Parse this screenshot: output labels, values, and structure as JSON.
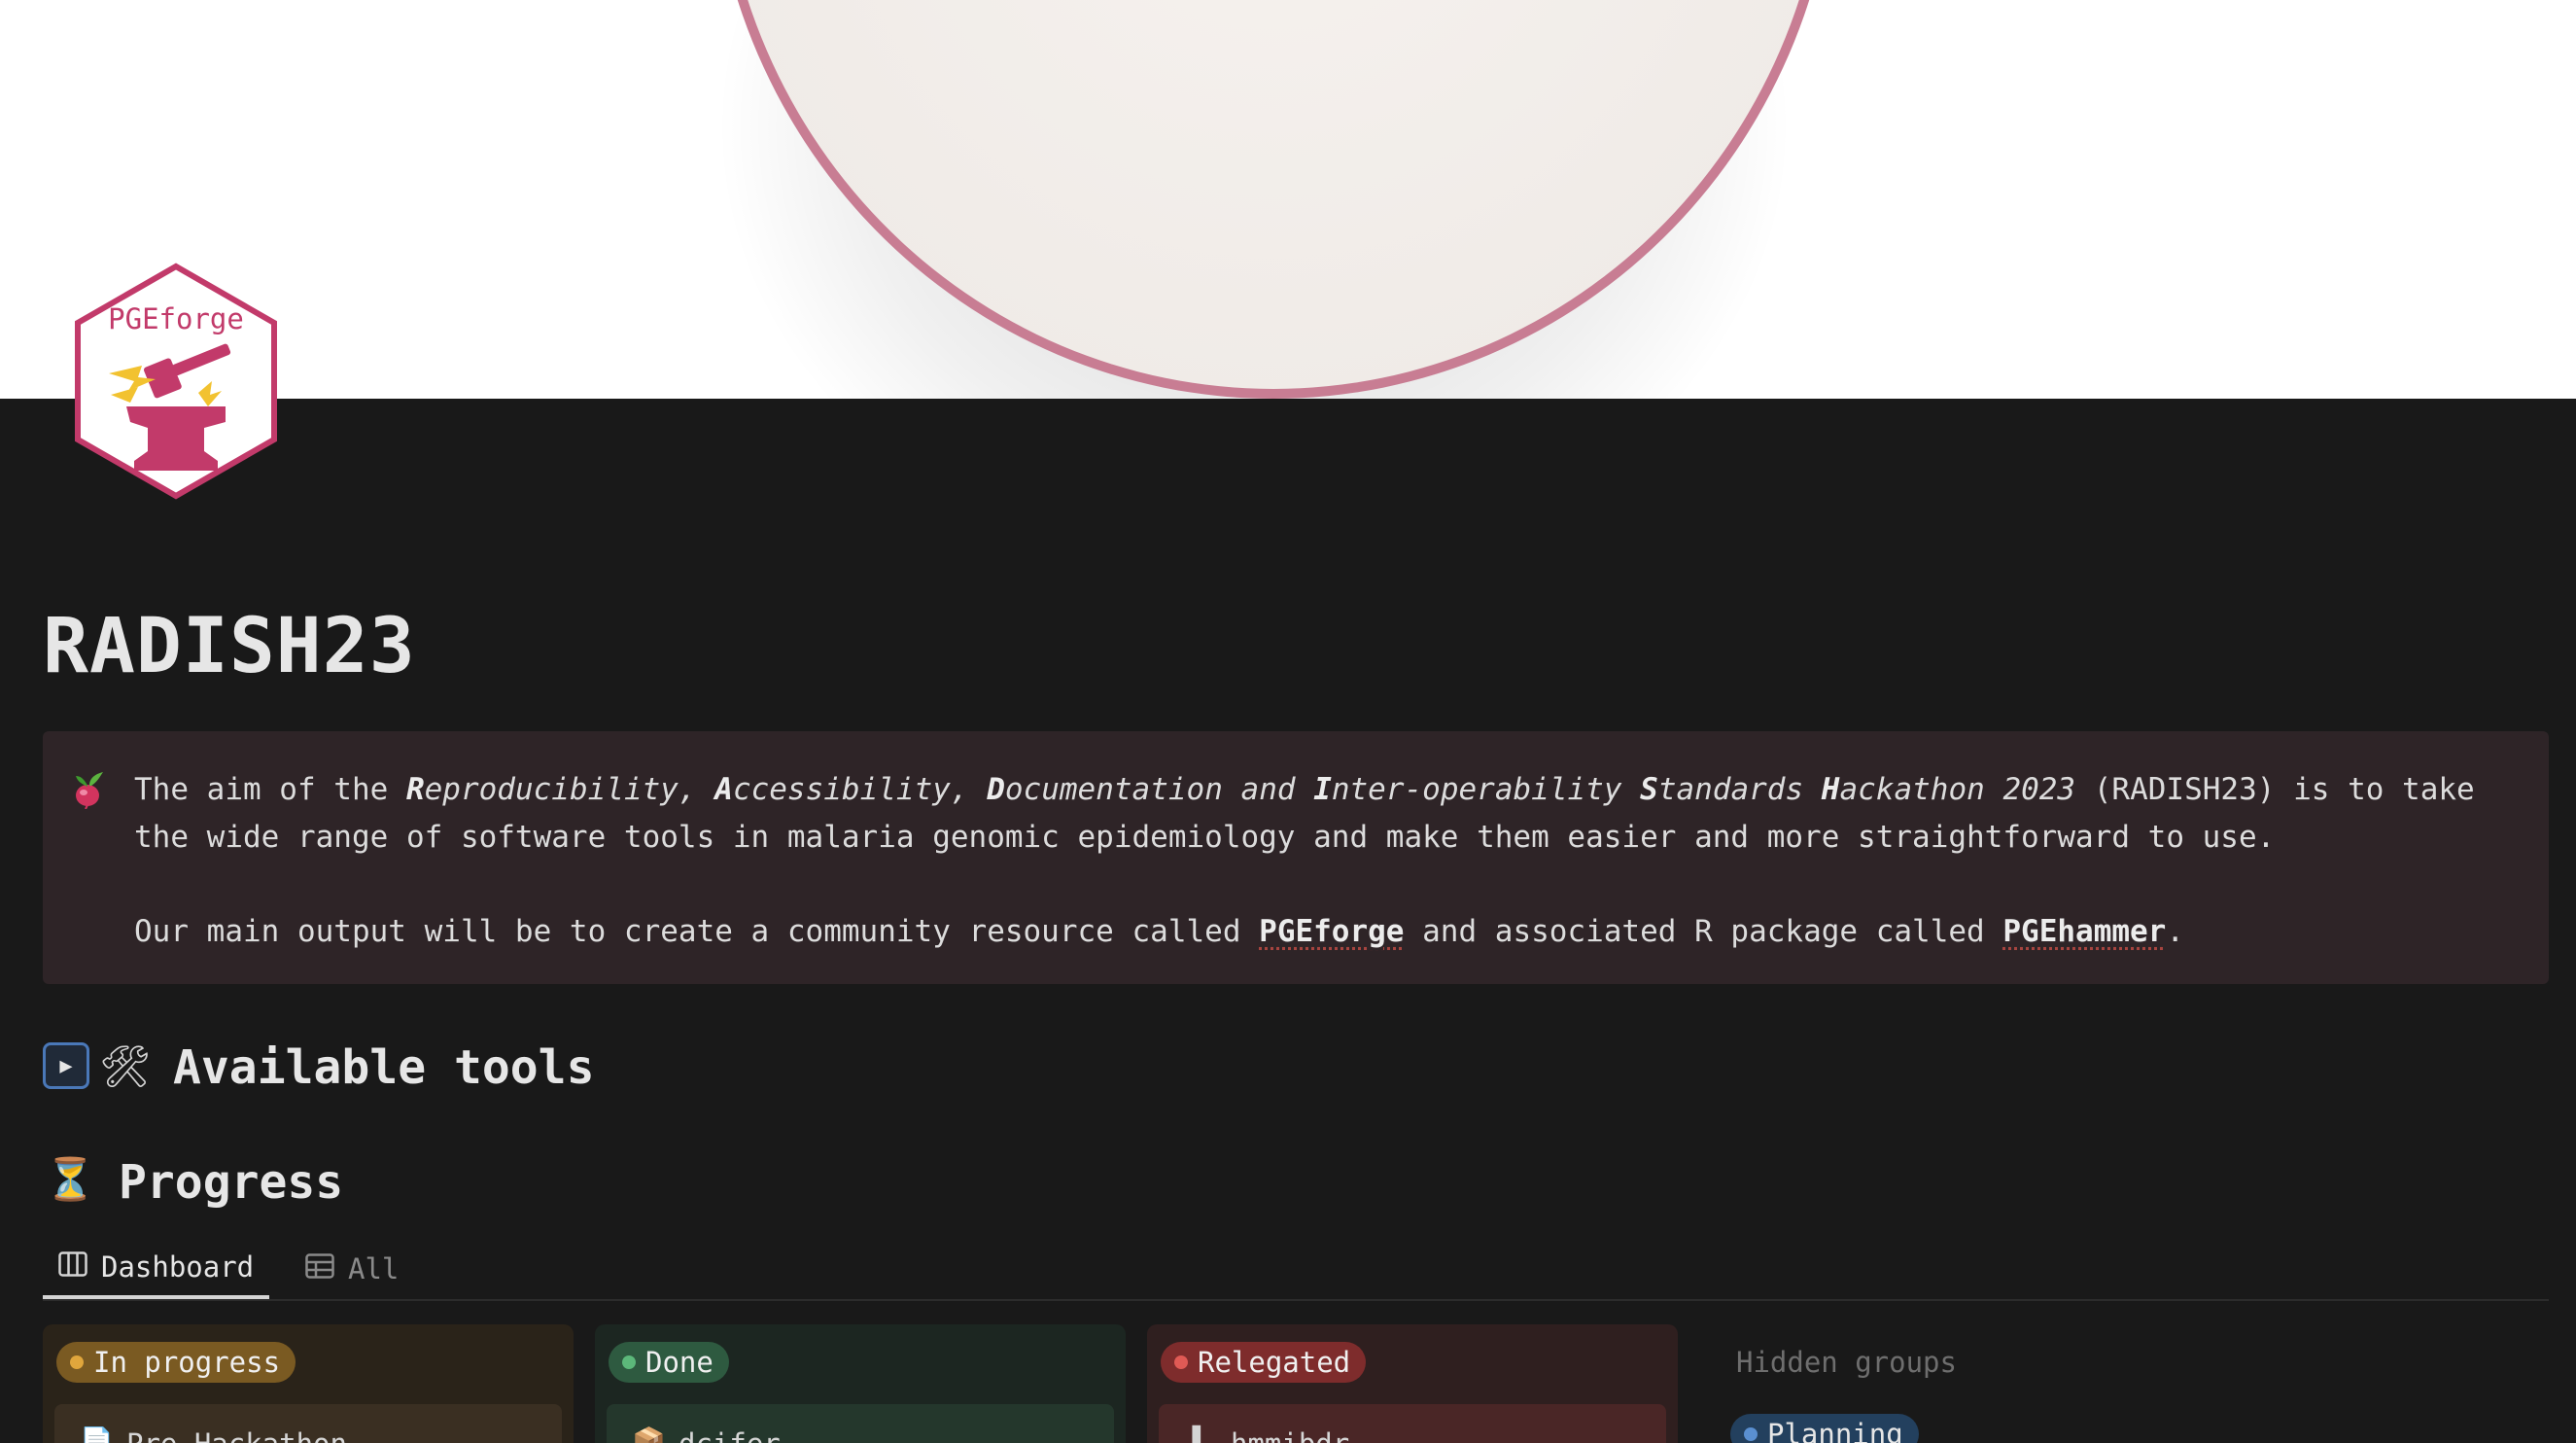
{
  "page": {
    "title": "RADISH23",
    "logo_text": "PGEforge"
  },
  "callout": {
    "icon": "radish-emoji",
    "intro": "The aim of the ",
    "name_parts": [
      {
        "initial": "R",
        "rest": "eproducibility, "
      },
      {
        "initial": "A",
        "rest": "ccessibility, "
      },
      {
        "initial": "D",
        "rest": "ocumentation and "
      },
      {
        "initial": "I",
        "rest": "nter-operability "
      },
      {
        "initial": "S",
        "rest": "tandards "
      },
      {
        "initial": "H",
        "rest": "ackathon 2023"
      }
    ],
    "outro": " (RADISH23) is to take the wide range of software tools in malaria genomic epidemiology and make them easier and more straightforward to use.",
    "para2_before": "Our main output will be to create a community resource called ",
    "link1": "PGEforge",
    "para2_mid": " and associated R package called ",
    "link2": "PGEhammer",
    "para2_end": "."
  },
  "sections": {
    "tools_heading": "Available tools",
    "tools_icon": "hammer-and-wrench-icon",
    "progress_heading": "Progress",
    "progress_icon": "hourglass-icon"
  },
  "tabs": [
    {
      "label": "Dashboard",
      "icon": "board-icon",
      "active": true
    },
    {
      "label": "All",
      "icon": "table-icon",
      "active": false
    }
  ],
  "board": {
    "columns": [
      {
        "status": "In progress",
        "color": "#e0a63c",
        "card": "Pre-Hackathon"
      },
      {
        "status": "Done",
        "color": "#5cb87a",
        "card": "dcifer"
      },
      {
        "status": "Relegated",
        "color": "#e05a55",
        "card": "hmmibdr"
      }
    ],
    "hidden_label": "Hidden groups",
    "hidden_groups": [
      "Planning"
    ]
  }
}
